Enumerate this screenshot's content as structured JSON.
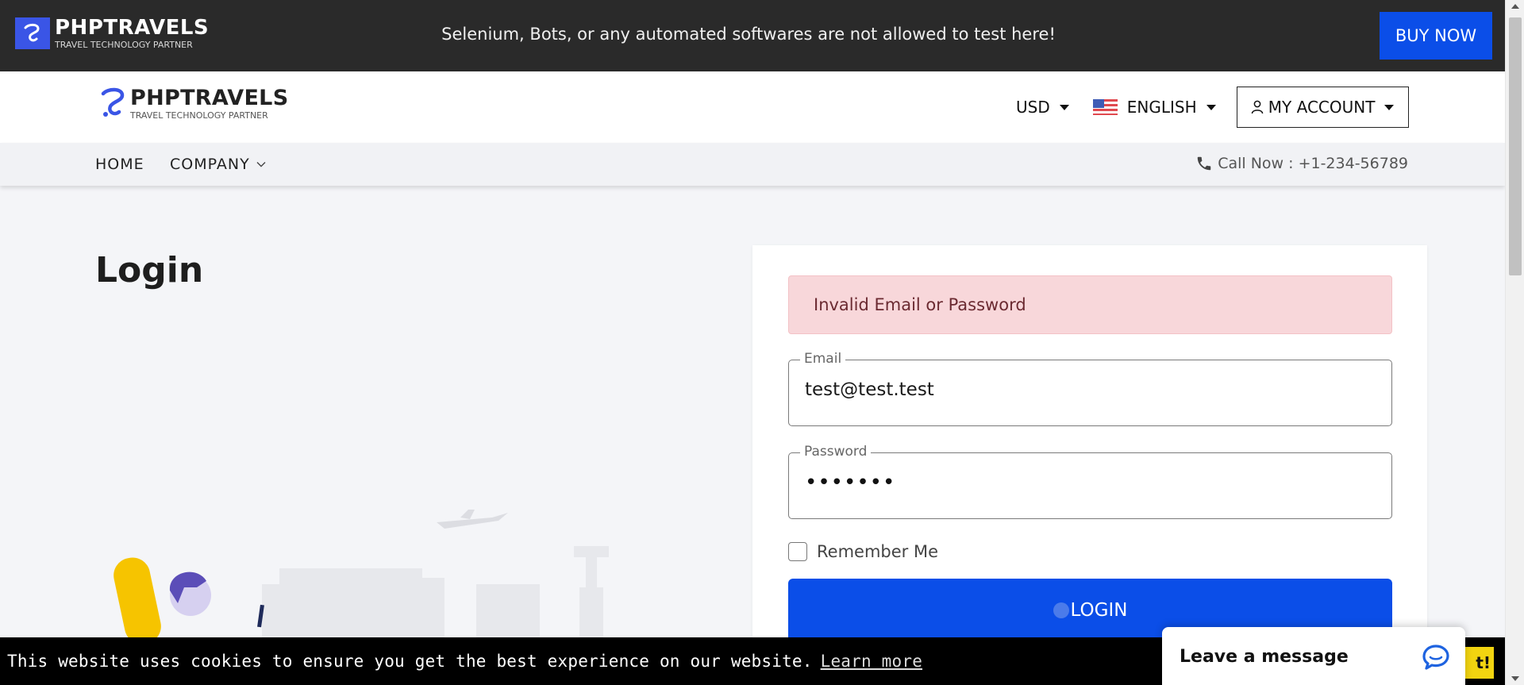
{
  "topbar": {
    "logo_text": "PHPTRAVELS",
    "logo_tagline": "TRAVEL TECHNOLOGY PARTNER",
    "notice": "Selenium, Bots, or any automated softwares are not allowed to test here!",
    "buy_now": "BUY NOW"
  },
  "header": {
    "logo_text": "PHPTRAVELS",
    "logo_tagline": "TRAVEL TECHNOLOGY PARTNER",
    "currency": "USD",
    "language": "ENGLISH",
    "account": "MY ACCOUNT"
  },
  "nav": {
    "home": "HOME",
    "company": "COMPANY",
    "call": "Call Now : +1-234-56789"
  },
  "main": {
    "title": "Login",
    "alert": "Invalid Email or Password",
    "email_label": "Email",
    "email_value": "test@test.test",
    "password_label": "Password",
    "password_mask": "•••••••",
    "remember_label": "Remember Me",
    "login_button": "LOGIN"
  },
  "cookie": {
    "message": "This website uses cookies to ensure you get the best experience on our website.",
    "learn_more": "Learn more",
    "button_partial": "t!"
  },
  "chat": {
    "label": "Leave a message"
  },
  "colors": {
    "primary": "#0b4ee8",
    "topbar": "#2a2a2a",
    "alert_bg": "#f8d7da",
    "cookie_button": "#f2d410"
  }
}
